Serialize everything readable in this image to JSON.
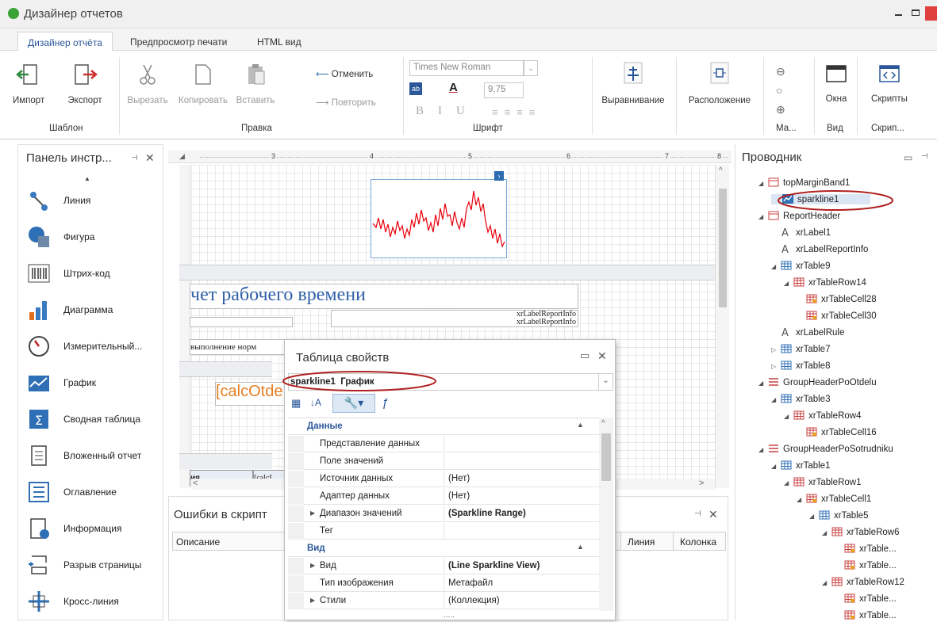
{
  "app": {
    "title": "Дизайнер отчетов"
  },
  "tabs": [
    "Дизайнер отчёта",
    "Предпросмотр печати",
    "HTML вид"
  ],
  "ribbon": {
    "template": {
      "import": "Импорт",
      "export": "Экспорт",
      "group": "Шаблон"
    },
    "edit": {
      "cut": "Вырезать",
      "copy": "Копировать",
      "paste": "Вставить",
      "undo": "Отменить",
      "redo": "Повторить",
      "group": "Правка"
    },
    "font": {
      "family": "Times New Roman",
      "size": "9,75",
      "group": "Шрифт"
    },
    "align": {
      "label": "Выравнивание"
    },
    "layout": {
      "label": "Расположение"
    },
    "zoom": {
      "group": "Ма..."
    },
    "view": {
      "windows": "Окна",
      "group": "Вид"
    },
    "scripts": {
      "label": "Скрипты",
      "group": "Скрип..."
    }
  },
  "toolbox": {
    "title": "Панель инстр...",
    "items": [
      "Линия",
      "Фигура",
      "Штрих-код",
      "Диаграмма",
      "Измерительный...",
      "График",
      "Сводная таблица",
      "Вложенный отчет",
      "Оглавление",
      "Информация",
      "Разрыв страницы",
      "Кросс-линия"
    ]
  },
  "ruler": {
    "marks": [
      "3",
      "4",
      "5",
      "6",
      "7",
      "8"
    ]
  },
  "canvas": {
    "report_title": "чет рабочего времени",
    "label_report_info_1": "xrLabelReportInfo",
    "label_report_info_2": "xrLabelReportInfo",
    "norm_text": "выполнение норм",
    "calc_field": "[calcOtde",
    "cell_a": "ия",
    "cell_b": "[calcI"
  },
  "errors_panel": {
    "title": "Ошибки в скрипт",
    "cols": [
      "Описание",
      "Линия",
      "Колонка"
    ]
  },
  "properties": {
    "title": "Таблица свойств",
    "selected": "sparkline1  График",
    "categories": [
      {
        "name": "Данные",
        "rows": [
          {
            "name": "Представление данных",
            "value": ""
          },
          {
            "name": "Поле значений",
            "value": ""
          },
          {
            "name": "Источник данных",
            "value": "(Нет)"
          },
          {
            "name": "Адаптер данных",
            "value": "(Нет)"
          },
          {
            "name": "Диапазон значений",
            "value": "(Sparkline Range)"
          },
          {
            "name": "Тег",
            "value": ""
          }
        ]
      },
      {
        "name": "Вид",
        "rows": [
          {
            "name": "Вид",
            "value": "(Line Sparkline View)"
          },
          {
            "name": "Тип изображения",
            "value": "Метафайл"
          },
          {
            "name": "Стили",
            "value": "(Коллекция)"
          }
        ]
      }
    ],
    "ellipsis": "....."
  },
  "explorer": {
    "title": "Проводник",
    "items": [
      {
        "label": "topMarginBand1",
        "icon": "band"
      },
      {
        "label": "sparkline1",
        "icon": "sparkline"
      },
      {
        "label": "ReportHeader",
        "icon": "band"
      },
      {
        "label": "xrLabel1",
        "icon": "label"
      },
      {
        "label": "xrLabelReportInfo",
        "icon": "label"
      },
      {
        "label": "xrTable9",
        "icon": "table"
      },
      {
        "label": "xrTableRow14",
        "icon": "row"
      },
      {
        "label": "xrTableCell28",
        "icon": "cell"
      },
      {
        "label": "xrTableCell30",
        "icon": "cell"
      },
      {
        "label": "xrLabelRule",
        "icon": "label"
      },
      {
        "label": "xrTable7",
        "icon": "table"
      },
      {
        "label": "xrTable8",
        "icon": "table"
      },
      {
        "label": "GroupHeaderPoOtdelu",
        "icon": "group"
      },
      {
        "label": "xrTable3",
        "icon": "table"
      },
      {
        "label": "xrTableRow4",
        "icon": "row"
      },
      {
        "label": "xrTableCell16",
        "icon": "cell"
      },
      {
        "label": "GroupHeaderPoSotrudniku",
        "icon": "group"
      },
      {
        "label": "xrTable1",
        "icon": "table"
      },
      {
        "label": "xrTableRow1",
        "icon": "row"
      },
      {
        "label": "xrTableCell1",
        "icon": "cell"
      },
      {
        "label": "xrTable5",
        "icon": "table"
      },
      {
        "label": "xrTableRow6",
        "icon": "row"
      },
      {
        "label": "xrTable...",
        "icon": "cell"
      },
      {
        "label": "xrTable...",
        "icon": "cell"
      },
      {
        "label": "xrTableRow12",
        "icon": "row"
      },
      {
        "label": "xrTable...",
        "icon": "cell"
      },
      {
        "label": "xrTable...",
        "icon": "cell"
      }
    ]
  },
  "colors": {
    "accent": "#2b579a",
    "highlight": "#c00000",
    "sparkline": "#e8000b"
  }
}
